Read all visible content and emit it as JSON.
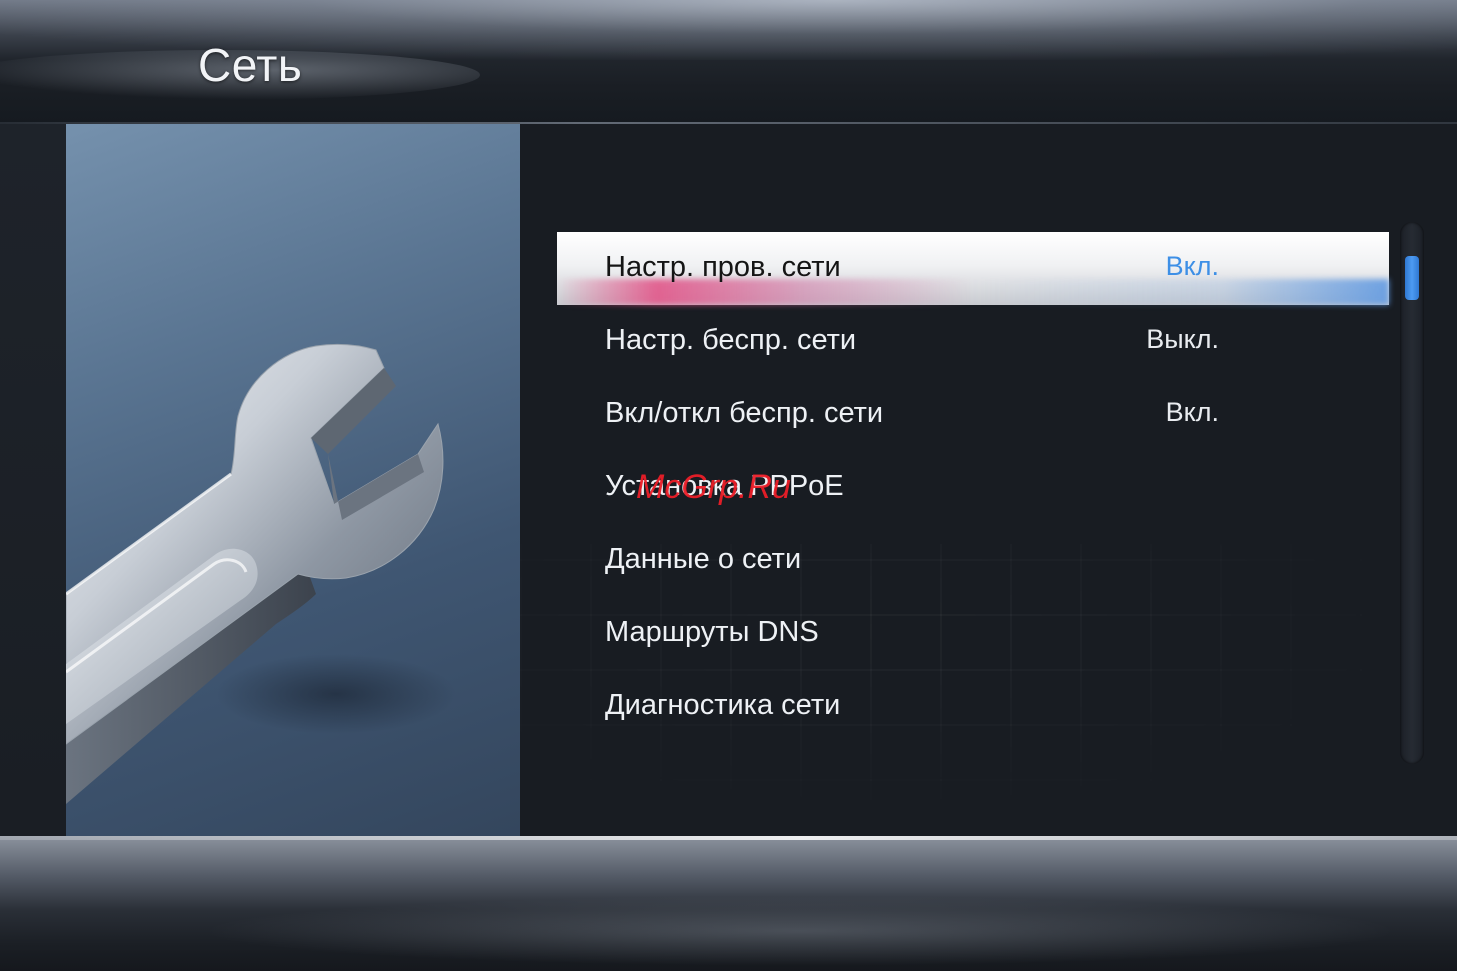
{
  "header": {
    "title": "Сеть"
  },
  "menu": {
    "selected_index": 0,
    "items": [
      {
        "label": "Настр. пров. сети",
        "value": "Вкл."
      },
      {
        "label": "Настр. беспр. сети",
        "value": "Выкл."
      },
      {
        "label": "Вкл/откл беспр. сети",
        "value": "Вкл."
      },
      {
        "label": "Установка PPPoE",
        "value": ""
      },
      {
        "label": "Данные о сети",
        "value": ""
      },
      {
        "label": "Маршруты DNS",
        "value": ""
      },
      {
        "label": "Диагностика сети",
        "value": ""
      }
    ]
  },
  "art": {
    "icon": "wrench-icon"
  },
  "watermark": {
    "text": "McGrp.Ru"
  },
  "colors": {
    "accent_value": "#3d8fe6",
    "selection_bg": "#f0f1f3",
    "watermark": "#eb1e28",
    "scroll_thumb": "#4d9bf2"
  }
}
